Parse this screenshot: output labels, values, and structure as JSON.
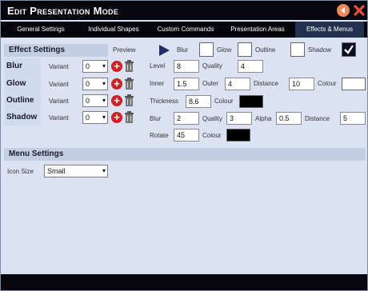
{
  "window": {
    "title": "Edit Presentation Mode"
  },
  "tabs": [
    {
      "label": "General Settings"
    },
    {
      "label": "Individual Shapes"
    },
    {
      "label": "Custom Commands"
    },
    {
      "label": "Presentation Areas"
    },
    {
      "label": "Effects & Menus",
      "active": true
    }
  ],
  "effect_settings": {
    "header": "Effect Settings",
    "preview_label": "Preview",
    "rows": [
      {
        "label": "Blur",
        "variant_label": "Variant",
        "variant_value": "0"
      },
      {
        "label": "Glow",
        "variant_label": "Variant",
        "variant_value": "0"
      },
      {
        "label": "Outline",
        "variant_label": "Variant",
        "variant_value": "0"
      },
      {
        "label": "Shadow",
        "variant_label": "Variant",
        "variant_value": "0"
      }
    ],
    "toggles": {
      "blur_label": "Blur",
      "blur_checked": false,
      "glow_label": "Glow",
      "glow_checked": false,
      "outline_label": "Outline",
      "outline_checked": false,
      "shadow_label": "Shadow",
      "shadow_checked": true
    },
    "blur": {
      "level_label": "Level",
      "level": "8",
      "quality_label": "Quality",
      "quality": "4"
    },
    "glow": {
      "inner_label": "Inner",
      "inner": "1.5",
      "outer_label": "Outer",
      "outer": "4",
      "distance_label": "Distance",
      "distance": "10",
      "colour_label": "Colour",
      "colour": "#ffffff"
    },
    "outline": {
      "thickness_label": "Thickness",
      "thickness": "8.6",
      "colour_label": "Colour",
      "colour": "#000000"
    },
    "shadow": {
      "blur_label": "Blur",
      "blur": "2",
      "quality_label": "Quality",
      "quality": "3",
      "alpha_label": "Alpha",
      "alpha": "0.5",
      "distance_label": "Distance",
      "distance": "5",
      "rotate_label": "Rotate",
      "rotate": "45",
      "colour_label": "Colour",
      "colour": "#000000"
    }
  },
  "menu_settings": {
    "header": "Menu Settings",
    "icon_size_label": "Icon Size",
    "icon_size_value": "Small"
  },
  "colors": {
    "titlebar": "#06060c",
    "panel": "#dbe3f3",
    "accent_red": "#cc2323",
    "back_button": "#f08a5d"
  },
  "icons": {
    "back": "back-arrow-icon",
    "close": "close-icon",
    "add": "add-icon",
    "delete": "trash-icon",
    "preview": "play-icon"
  }
}
